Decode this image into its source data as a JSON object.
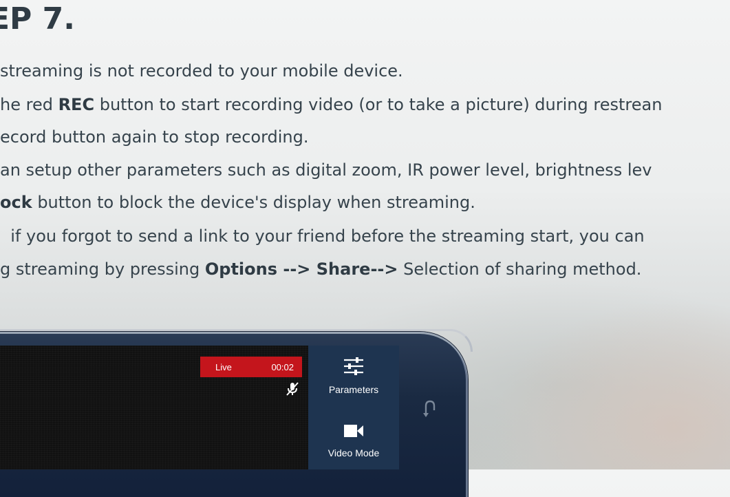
{
  "page": {
    "heading": "EP 7.",
    "lines": [
      {
        "pre": "streaming is not recorded to your mobile device.",
        "b1": "",
        "mid": "",
        "b2": "",
        "post": ""
      },
      {
        "pre": "he red ",
        "b1": "REC",
        "mid": " button to start recording video (or to take a picture) during restrean",
        "b2": "",
        "post": ""
      },
      {
        "pre": "ecord button again to stop recording.",
        "b1": "",
        "mid": "",
        "b2": "",
        "post": ""
      },
      {
        "pre": "an setup other parameters such as digital zoom, IR power level, brightness lev",
        "b1": "",
        "mid": "",
        "b2": "",
        "post": ""
      },
      {
        "pre": "",
        "b1": "ock",
        "mid": " button to block the device's display when streaming.",
        "b2": "",
        "post": ""
      },
      {
        "pre": "  if you forgot to send a link to your friend before the streaming start, you can",
        "b1": "",
        "mid": "",
        "b2": "",
        "post": ""
      },
      {
        "pre": "g streaming by pressing ",
        "b1": "Options --> Share-->",
        "mid": " Selection of sharing method.",
        "b2": "",
        "post": ""
      }
    ]
  },
  "phone": {
    "live_badge": {
      "label": "Live",
      "time": "00:02"
    },
    "panel": {
      "parameters_label": "Parameters",
      "video_mode_label": "Video Mode"
    },
    "icons": {
      "mic": "mic-off-icon",
      "parameters": "sliders-icon",
      "video_mode": "video-camera-icon",
      "back": "back-arrow-icon"
    },
    "colors": {
      "live_badge": "#c4151c",
      "panel": "#1e3450",
      "phone_body": "#1a2a42"
    }
  }
}
